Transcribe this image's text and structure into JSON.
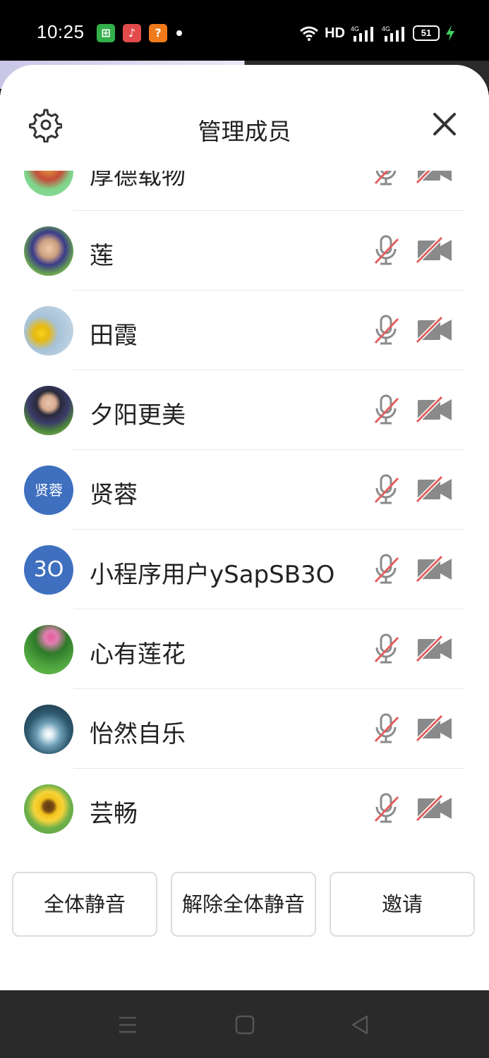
{
  "status_bar": {
    "time": "10:25",
    "network_label": "HD",
    "signal_1": "4G",
    "signal_2": "4G",
    "battery": "51"
  },
  "sheet": {
    "title": "管理成员"
  },
  "members": [
    {
      "name": "厚德载物",
      "avatar": "photo-flower"
    },
    {
      "name": "莲",
      "avatar": "photo-person"
    },
    {
      "name": "田霞",
      "avatar": "photo-yellow-flower"
    },
    {
      "name": "夕阳更美",
      "avatar": "photo-person"
    },
    {
      "name": "贤蓉",
      "avatar": "initials",
      "initials": "贤蓉"
    },
    {
      "name": "小程序用户ySapSB3O",
      "avatar": "initials",
      "initials": "3O"
    },
    {
      "name": "心有莲花",
      "avatar": "photo-lotus"
    },
    {
      "name": "怡然自乐",
      "avatar": "photo-dandelion"
    },
    {
      "name": "芸畅",
      "avatar": "photo-sunflower"
    }
  ],
  "actions": {
    "mute_all": "全体静音",
    "unmute_all": "解除全体静音",
    "invite": "邀请"
  },
  "colors": {
    "accent_red": "#e06060",
    "icon_gray": "#8a8a8a",
    "initials_bg": "#3f6fbf"
  }
}
